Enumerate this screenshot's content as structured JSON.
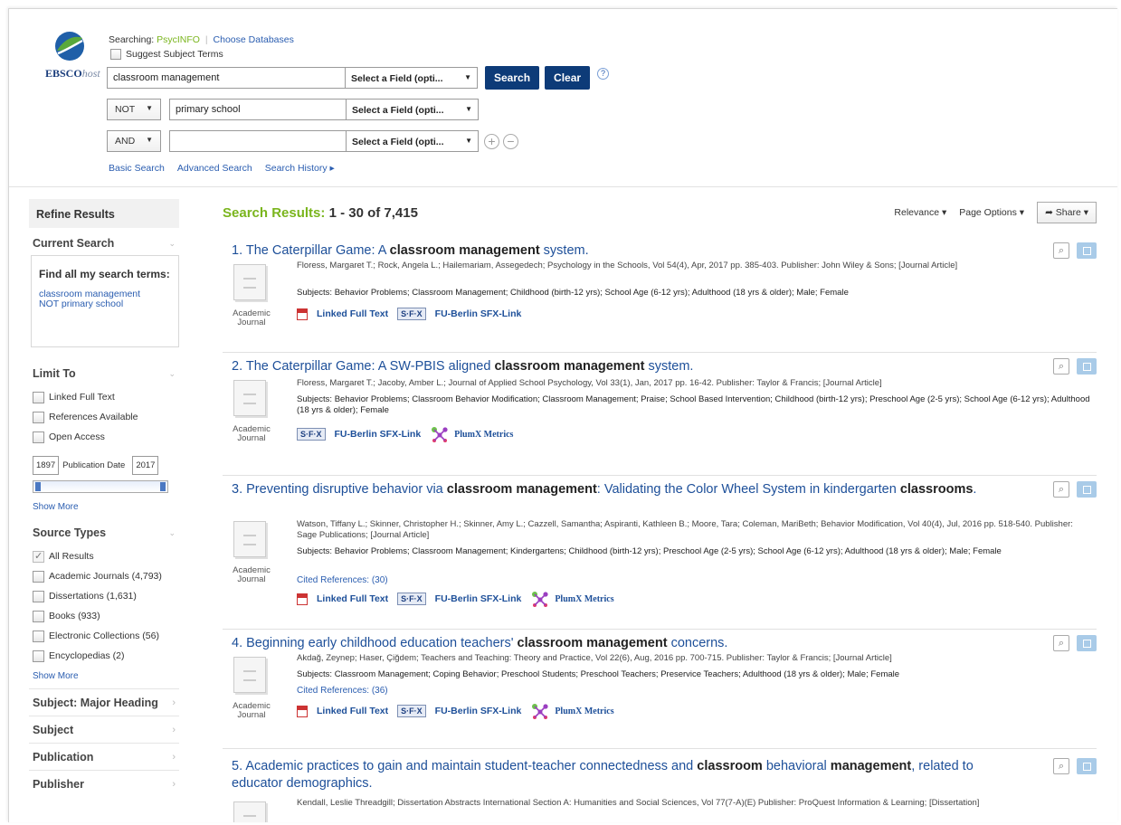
{
  "header": {
    "logo_text": "EBSCO",
    "logo_italic": "host",
    "searching_label": "Searching:",
    "database": "PsycINFO",
    "choose_databases": "Choose Databases",
    "suggest_subject_terms": "Suggest Subject Terms",
    "rows": [
      {
        "bool": "",
        "value": "classroom management",
        "field": "Select a Field (opti..."
      },
      {
        "bool": "NOT",
        "value": "primary school",
        "field": "Select a Field (opti..."
      },
      {
        "bool": "AND",
        "value": "",
        "field": "Select a Field (opti..."
      }
    ],
    "search_button": "Search",
    "clear_button": "Clear",
    "help": "?",
    "links": {
      "basic": "Basic Search",
      "advanced": "Advanced Search",
      "history": "Search History ▸"
    }
  },
  "sidebar": {
    "refine": "Refine Results",
    "current_search": "Current Search",
    "find_all": "Find all my search terms:",
    "terms_1": "classroom management",
    "terms_2": "NOT primary school",
    "limit_to": "Limit To",
    "limits": [
      "Linked Full Text",
      "References Available",
      "Open Access"
    ],
    "pub_start": "1897",
    "pub_label": "Publication Date",
    "pub_end": "2017",
    "show_more": "Show More",
    "source_types": "Source Types",
    "sources": [
      {
        "label": "All Results",
        "checked": true
      },
      {
        "label": "Academic Journals (4,793)",
        "checked": false
      },
      {
        "label": "Dissertations (1,631)",
        "checked": false
      },
      {
        "label": "Books (933)",
        "checked": false
      },
      {
        "label": "Electronic Collections (56)",
        "checked": false
      },
      {
        "label": "Encyclopedias (2)",
        "checked": false
      }
    ],
    "facets": [
      "Subject: Major Heading",
      "Subject",
      "Publication",
      "Publisher"
    ]
  },
  "results": {
    "label": "Search Results:",
    "range": "1 - 30 of 7,415",
    "relevance": "Relevance ▾",
    "page_options": "Page Options ▾",
    "share": "Share ▾",
    "doc_type_1": "Academic",
    "doc_type_2": "Journal",
    "linked_full_text": "Linked Full Text",
    "sfx": "S·F·X",
    "sfx_link": "FU-Berlin SFX-Link",
    "plumx": "PlumX Metrics",
    "records": [
      {
        "n": "1.",
        "title_pre": "The Caterpillar Game: A ",
        "title_bold": "classroom management",
        "title_post": " system.",
        "meta": "Floress, Margaret T.; Rock, Angela L.; Hailemariam, Assegedech; Psychology in the Schools, Vol 54(4), Apr, 2017 pp. 385-403. Publisher: John Wiley & Sons; [Journal Article]",
        "subjects": "Subjects: Behavior Problems; Classroom Management; Childhood (birth-12 yrs); School Age (6-12 yrs); Adulthood (18 yrs & older); Male; Female"
      },
      {
        "n": "2.",
        "title_pre": "The Caterpillar Game: A SW-PBIS aligned ",
        "title_bold": "classroom management",
        "title_post": " system.",
        "meta": "Floress, Margaret T.; Jacoby, Amber L.; Journal of Applied School Psychology, Vol 33(1), Jan, 2017 pp. 16-42. Publisher: Taylor & Francis; [Journal Article]",
        "subjects": "Subjects: Behavior Problems; Classroom Behavior Modification; Classroom Management; Praise; School Based Intervention; Childhood (birth-12 yrs); Preschool Age (2-5 yrs); School Age (6-12 yrs); Adulthood (18 yrs & older); Female"
      },
      {
        "n": "3.",
        "title_pre": "Preventing disruptive behavior via ",
        "title_bold": "classroom management",
        "title_post": ": Validating the Color Wheel System in kindergarten ",
        "title_bold2": "classrooms",
        "title_post2": ".",
        "meta": "Watson, Tiffany L.; Skinner, Christopher H.; Skinner, Amy L.; Cazzell, Samantha; Aspiranti, Kathleen B.; Moore, Tara; Coleman, MariBeth; Behavior Modification, Vol 40(4), Jul, 2016 pp. 518-540. Publisher: Sage Publications; [Journal Article]",
        "subjects": "Subjects: Behavior Problems; Classroom Management; Kindergartens; Childhood (birth-12 yrs); Preschool Age (2-5 yrs); School Age (6-12 yrs); Adulthood (18 yrs & older); Male; Female",
        "cited": "Cited References: (30)"
      },
      {
        "n": "4.",
        "title_pre": "Beginning early childhood education teachers' ",
        "title_bold": "classroom management",
        "title_post": " concerns.",
        "meta": "Akdağ, Zeynep; Haser, Çiğdem; Teachers and Teaching: Theory and Practice, Vol 22(6), Aug, 2016 pp. 700-715. Publisher: Taylor & Francis; [Journal Article]",
        "subjects": "Subjects: Classroom Management; Coping Behavior; Preschool Students; Preschool Teachers; Preservice Teachers; Adulthood (18 yrs & older); Male; Female",
        "cited": "Cited References: (36)"
      },
      {
        "n": "5.",
        "title_pre": "Academic practices to gain and maintain student-teacher connectedness and ",
        "title_bold": "classroom",
        "title_post": " behavioral ",
        "title_bold2": "management",
        "title_post2": ", related to educator demographics.",
        "meta": "Kendall, Leslie Threadgill; Dissertation Abstracts International Section A: Humanities and Social Sciences, Vol 77(7-A)(E) Publisher: ProQuest Information & Learning; [Dissertation]"
      }
    ]
  }
}
